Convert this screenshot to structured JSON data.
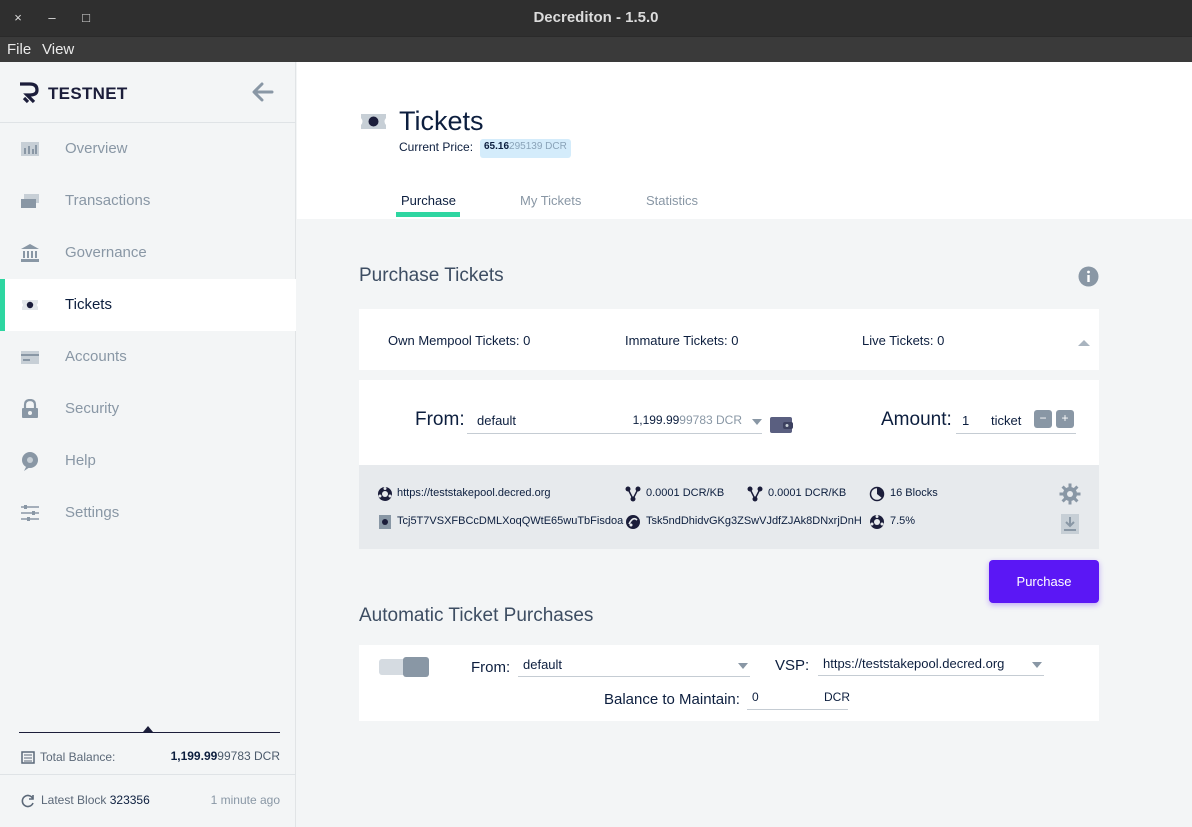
{
  "window": {
    "title": "Decrediton - 1.5.0",
    "close": "×",
    "minimize": "–",
    "maximize": "□"
  },
  "menu": {
    "file": "File",
    "view": "View"
  },
  "sidebar": {
    "network": "TESTNET",
    "items": [
      {
        "label": "Overview",
        "icon": "overview-icon"
      },
      {
        "label": "Transactions",
        "icon": "transactions-icon"
      },
      {
        "label": "Governance",
        "icon": "governance-icon"
      },
      {
        "label": "Tickets",
        "icon": "tickets-icon"
      },
      {
        "label": "Accounts",
        "icon": "accounts-icon"
      },
      {
        "label": "Security",
        "icon": "lock-icon"
      },
      {
        "label": "Help",
        "icon": "help-icon"
      },
      {
        "label": "Settings",
        "icon": "settings-sliders-icon"
      }
    ],
    "active_item": "Tickets",
    "total_balance_label": "Total Balance:",
    "total_balance_main": "1,199.99",
    "total_balance_rest": "99783 DCR",
    "latest_block_label": "Latest Block",
    "latest_block_value": "323356",
    "latest_block_time": "1 minute ago"
  },
  "header": {
    "title": "Tickets",
    "current_price_label": "Current Price:",
    "price_main": "65.16",
    "price_rest": "295139 DCR",
    "tabs": [
      "Purchase",
      "My Tickets",
      "Statistics"
    ],
    "active_tab": "Purchase"
  },
  "purchase": {
    "title": "Purchase Tickets",
    "own_mempool": "Own Mempool Tickets: 0",
    "immature": "Immature Tickets: 0",
    "live": "Live Tickets: 0",
    "from_label": "From:",
    "account": "default",
    "balance_main": "1,199.99",
    "balance_rest": "99783 DCR",
    "amount_label": "Amount:",
    "amount_value": "1",
    "amount_unit": "ticket",
    "minus": "−",
    "plus": "+",
    "vsp_url": "https://teststakepool.decred.org",
    "fee1": "0.0001 DCR/KB",
    "fee2": "0.0001 DCR/KB",
    "expiry": "16 Blocks",
    "ticket_address": "Tcj5T7VSXFBCcDMLXoqQWtE65wuTbFisdoa",
    "fee_address": "Tsk5ndDhidvGKg3ZSwVJdfZJAk8DNxrjDnH",
    "pool_fee": "7.5%",
    "button": "Purchase"
  },
  "auto": {
    "title": "Automatic Ticket Purchases",
    "from_label": "From:",
    "account": "default",
    "vsp_label": "VSP:",
    "vsp_value": "https://teststakepool.decred.org",
    "balance_label": "Balance to Maintain:",
    "balance_value": "0",
    "balance_unit": "DCR",
    "enabled": false
  },
  "colors": {
    "accent": "#2ed6a1",
    "primary_button": "#5b17f5",
    "text": "#0c1e3e",
    "muted": "#8997a5"
  }
}
